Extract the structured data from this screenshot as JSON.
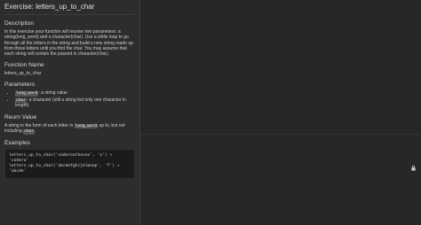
{
  "exercise": {
    "title": "Exercise: letters_up_to_char",
    "description_heading": "Description",
    "description": "In this exercise your function will receive two parameters: a string(long_word) and a character(char). Use a while loop to go through all the letters in the string and build a new string made up from those letters until you find the char. You may assume that each string will contain the passed in character(char).",
    "function_name_heading": "Function Name",
    "function_name": "letters_up_to_char",
    "parameters_heading": "Parameters",
    "parameters": [
      {
        "name": "long_word",
        "desc": ": a string value"
      },
      {
        "name": "char",
        "desc": ": a character (still a string but only one character in length)"
      }
    ],
    "return_heading": "Reurn Value",
    "return_text_1": "A string in the form of each letter in ",
    "return_code_1": "long_word",
    "return_text_2": " up to, but not including ",
    "return_code_2": "char",
    "return_text_3": ".",
    "examples_heading": "Examples",
    "examples": [
      "letters_up_to_char('coderoxthesox', 'x') → 'codero'",
      "letters_up_to_char('abcdefghijklmnop', 'f') → 'abcde'"
    ]
  },
  "icons": {
    "lock": "lock-icon"
  },
  "colors": {
    "panel_bg": "#2d2d2d",
    "editor_bg": "#262626",
    "code_bg": "#1b1b1b"
  }
}
